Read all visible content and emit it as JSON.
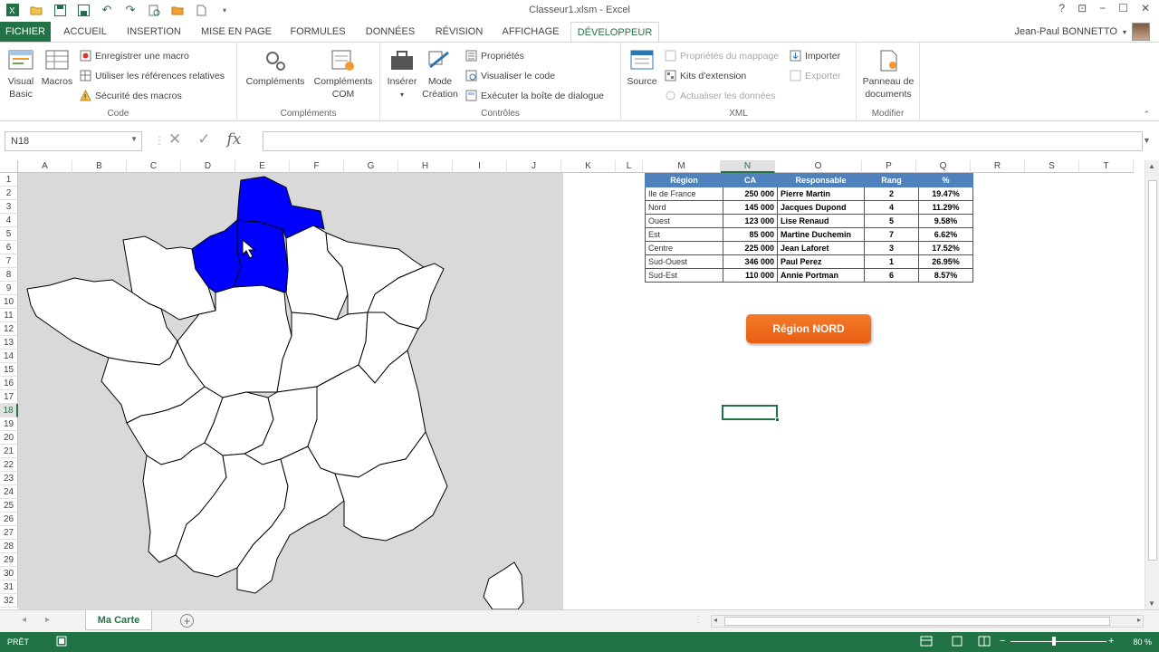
{
  "window": {
    "title": "Classeur1.xlsm - Excel",
    "help": "?",
    "restore": "⊡",
    "minimize": "−",
    "maximize": "☐",
    "close": "✕"
  },
  "qat": {
    "save_icon": "save-icon",
    "undo_icon": "undo-icon",
    "redo_icon": "redo-icon"
  },
  "tabs": [
    "FICHIER",
    "ACCUEIL",
    "INSERTION",
    "MISE EN PAGE",
    "FORMULES",
    "DONNÉES",
    "RÉVISION",
    "AFFICHAGE",
    "DÉVELOPPEUR"
  ],
  "user": {
    "name": "Jean-Paul BONNETTO"
  },
  "ribbon": {
    "code": {
      "name": "Code",
      "visual_basic": "Visual Basic",
      "macros": "Macros",
      "record": "Enregistrer une macro",
      "relative": "Utiliser les références relatives",
      "security": "Sécurité des macros"
    },
    "addins": {
      "name": "Compléments",
      "complements": "Compléments",
      "com": "Compléments COM"
    },
    "controls": {
      "name": "Contrôles",
      "insert": "Insérer",
      "design": "Mode Création",
      "props": "Propriétés",
      "view_code": "Visualiser le code",
      "dialog": "Exécuter la boîte de dialogue"
    },
    "xml": {
      "name": "XML",
      "source": "Source",
      "map_props": "Propriétés du mappage",
      "ext": "Kits d'extension",
      "refresh": "Actualiser les données",
      "import": "Importer",
      "export": "Exporter"
    },
    "modify": {
      "name": "Modifier",
      "doc_panel": "Panneau de documents"
    }
  },
  "formula": {
    "namebox": "N18",
    "cancel": "✕",
    "enter": "✓",
    "fx": "fx",
    "value": ""
  },
  "columns": [
    "A",
    "B",
    "C",
    "D",
    "E",
    "F",
    "G",
    "H",
    "I",
    "J",
    "K",
    "L",
    "M",
    "N",
    "O",
    "P",
    "Q",
    "R",
    "S",
    "T"
  ],
  "rows": [
    "1",
    "2",
    "3",
    "4",
    "5",
    "6",
    "7",
    "8",
    "9",
    "10",
    "11",
    "12",
    "13",
    "14",
    "15",
    "16",
    "17",
    "18",
    "19",
    "20",
    "21",
    "22",
    "23",
    "24",
    "25",
    "26",
    "27",
    "28",
    "29",
    "30",
    "31",
    "32"
  ],
  "selected": {
    "col": "N",
    "row": "18"
  },
  "table": {
    "headers": [
      "Région",
      "CA",
      "Responsable",
      "Rang",
      "%"
    ],
    "rows": [
      [
        "Ile de France",
        "250 000",
        "Pierre Martin",
        "2",
        "19.47%"
      ],
      [
        "Nord",
        "145 000",
        "Jacques Dupond",
        "4",
        "11.29%"
      ],
      [
        "Ouest",
        "123 000",
        "Lise Renaud",
        "5",
        "9.58%"
      ],
      [
        "Est",
        "85 000",
        "Martine Duchemin",
        "7",
        "6.62%"
      ],
      [
        "Centre",
        "225 000",
        "Jean Laforet",
        "3",
        "17.52%"
      ],
      [
        "Sud-Ouest",
        "346 000",
        "Paul Perez",
        "1",
        "26.95%"
      ],
      [
        "Sud-Est",
        "110 000",
        "Annie Portman",
        "6",
        "8.57%"
      ]
    ]
  },
  "button": {
    "label": "Région NORD"
  },
  "sheet": {
    "tab": "Ma Carte",
    "add": "+",
    "nav_prev": "◂",
    "nav_next": "▸"
  },
  "status": {
    "ready": "PRÊT",
    "zoom": "80 %"
  },
  "colors": {
    "accent": "#217346",
    "highlight_region": "#0000ff",
    "table_header": "#4f81bd",
    "button": "#ec6a1c"
  }
}
